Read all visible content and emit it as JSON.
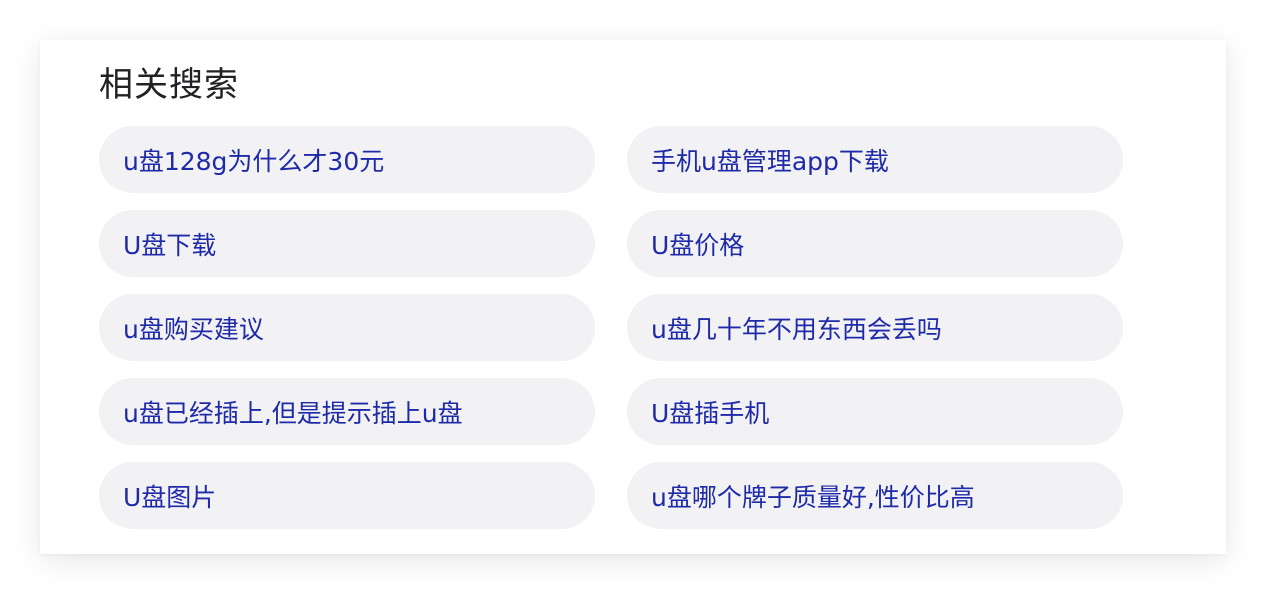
{
  "related_search": {
    "title": "相关搜索",
    "items": [
      {
        "label": "u盘128g为什么才30元"
      },
      {
        "label": "手机u盘管理app下载"
      },
      {
        "label": "U盘下载"
      },
      {
        "label": "U盘价格"
      },
      {
        "label": "u盘购买建议"
      },
      {
        "label": "u盘几十年不用东西会丢吗"
      },
      {
        "label": "u盘已经插上,但是提示插上u盘"
      },
      {
        "label": "U盘插手机"
      },
      {
        "label": "U盘图片"
      },
      {
        "label": "u盘哪个牌子质量好,性价比高"
      }
    ]
  },
  "colors": {
    "title_text": "#222226",
    "link_text": "#1f2aa8",
    "pill_background": "#f2f2f5",
    "card_background": "#ffffff"
  }
}
